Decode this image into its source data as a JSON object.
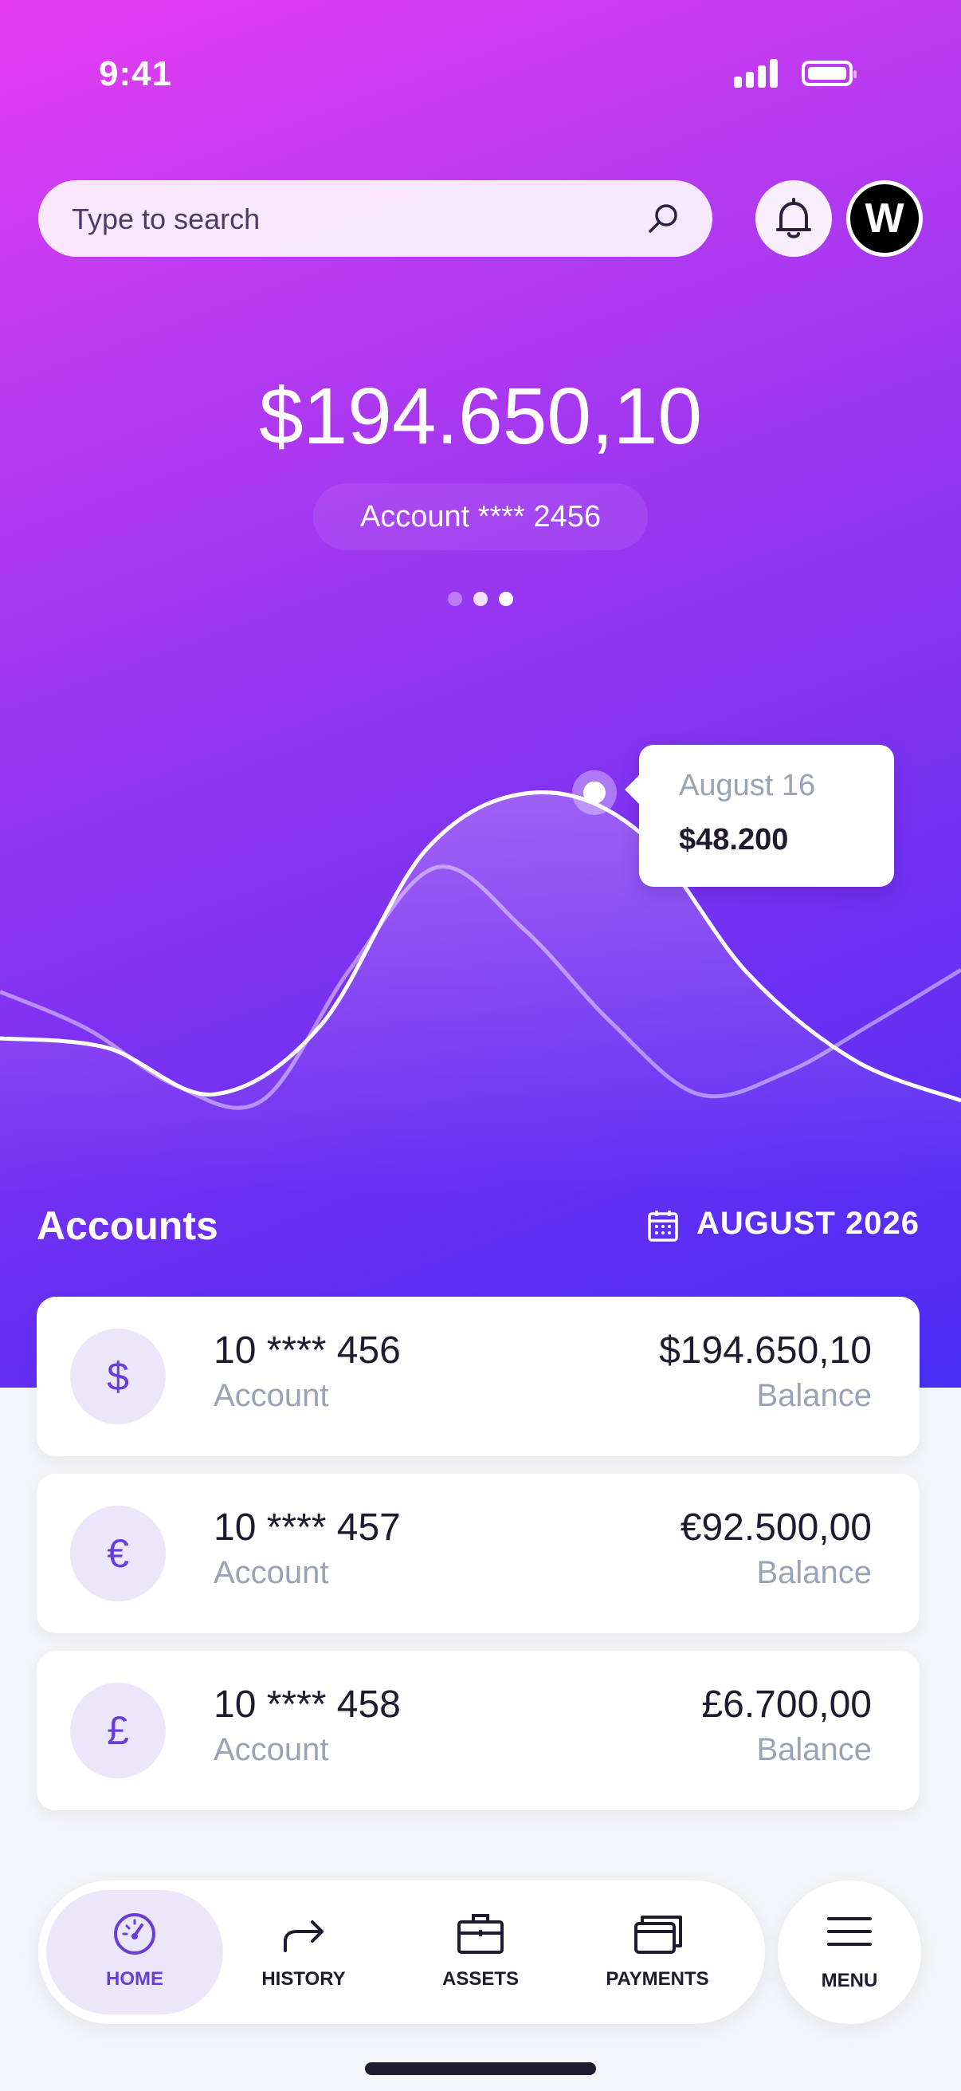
{
  "status_bar": {
    "time": "9:41"
  },
  "header": {
    "search_placeholder": "Type to search",
    "avatar_initial": "W"
  },
  "hero": {
    "balance": "$194.650,10",
    "account_label": "Account **** 2456",
    "pager": {
      "count": 3,
      "active_index": 2
    }
  },
  "chart_data": {
    "type": "line",
    "title": "",
    "series": [
      {
        "values": [
          0.35,
          0.23,
          0.05,
          0.0,
          0.42,
          0.75,
          0.55,
          0.25,
          0.02,
          0.09,
          0.25,
          0.42
        ]
      },
      {
        "values": [
          0.2,
          0.17,
          0.02,
          0.24,
          0.81,
          0.99,
          0.86,
          0.41,
          0.13,
          0.0
        ]
      }
    ],
    "tooltip": {
      "date": "August 16",
      "value": "$48.200"
    }
  },
  "accounts": {
    "title": "Accounts",
    "period": "AUGUST 2026",
    "items": [
      {
        "currency_symbol": "$",
        "number": "10 **** 456",
        "sub": "Account",
        "amount": "$194.650,10",
        "amount_label": "Balance"
      },
      {
        "currency_symbol": "€",
        "number": "10 **** 457",
        "sub": "Account",
        "amount": "€92.500,00",
        "amount_label": "Balance"
      },
      {
        "currency_symbol": "£",
        "number": "10 **** 458",
        "sub": "Account",
        "amount": "£6.700,00",
        "amount_label": "Balance"
      }
    ]
  },
  "nav": {
    "items": [
      {
        "label": "HOME",
        "icon": "dashboard-icon",
        "active": true
      },
      {
        "label": "HISTORY",
        "icon": "forward-arrow-icon"
      },
      {
        "label": "ASSETS",
        "icon": "briefcase-icon"
      },
      {
        "label": "PAYMENTS",
        "icon": "cards-icon"
      }
    ],
    "menu_label": "MENU"
  },
  "colors": {
    "accent": "#6a3dd8",
    "muted": "#9aa3b5",
    "text": "#1f1a2e"
  }
}
